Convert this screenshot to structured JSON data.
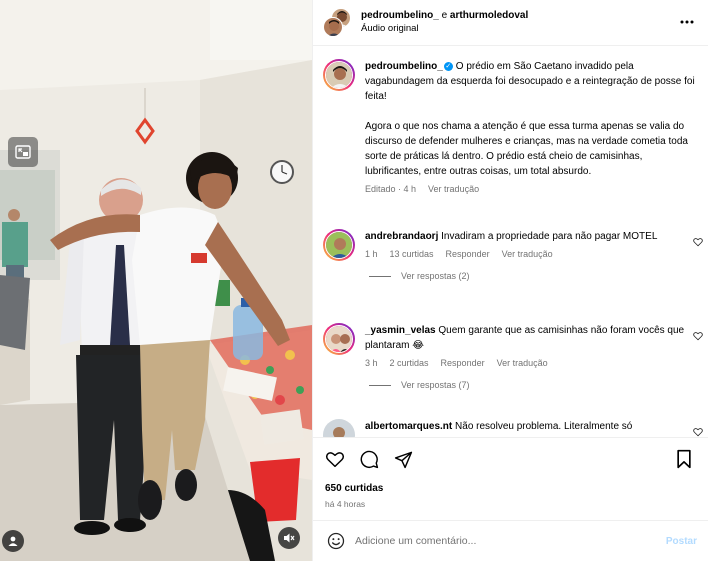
{
  "header": {
    "author1": "pedroumbelino_",
    "connector": " e ",
    "author2": "arthurmoledoval",
    "audio": "Áudio original"
  },
  "caption": {
    "username": "pedroumbelino_",
    "paragraph1": "O prédio em São Caetano invadido pela vagabundagem da esquerda foi desocupado e a reintegração de posse foi feita!",
    "paragraph2": "Agora o que nos chama a atenção é que essa turma apenas se valia do discurso de defender mulheres e crianças, mas na verdade cometia toda sorte de práticas lá dentro. O prédio está cheio de camisinhas, lubrificantes, entre outras coisas, um total absurdo.",
    "edited": "Editado · 4 h",
    "see_translation": "Ver tradução"
  },
  "comments": [
    {
      "username": "andrebrandaorj",
      "text": "Invadiram a propriedade para não pagar MOTEL",
      "time": "1 h",
      "likes": "13 curtidas",
      "reply": "Responder",
      "translate": "Ver tradução",
      "view_replies": "Ver respostas (2)"
    },
    {
      "username": "_yasmin_velas",
      "text": "Quem garante que as camisinhas não foram vocês que plantaram 😂",
      "time": "3 h",
      "likes": "2 curtidas",
      "reply": "Responder",
      "translate": "Ver tradução",
      "view_replies": "Ver respostas (7)"
    },
    {
      "username": "albertomarques.nt",
      "text": "Não resolveu problema. Literalmente só"
    }
  ],
  "post": {
    "likes": "650 curtidas",
    "time_ago": "há 4 horas"
  },
  "composer": {
    "placeholder": "Adicione um comentário...",
    "post_label": "Postar"
  },
  "colors": {
    "link_blue": "#0095f6",
    "muted": "#737373",
    "post_disabled": "#b3dbff"
  }
}
